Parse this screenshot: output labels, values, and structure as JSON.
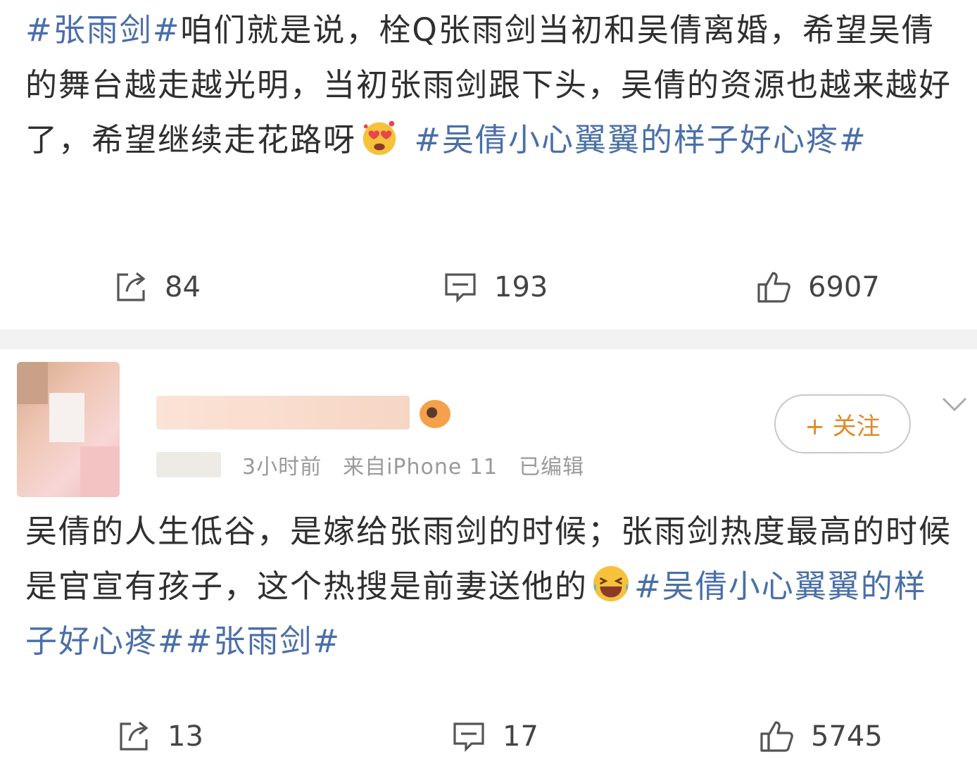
{
  "post1": {
    "text": [
      {
        "t": "#张雨剑#",
        "tag": true
      },
      {
        "t": "咱们就是说，栓Q张雨剑当初和吴倩离婚，希望吴倩的舞台越走越光明，当初张雨剑跟下头，吴倩的资源也越来越好了，希望继续走花路呀",
        "tag": false
      },
      {
        "emoji": "heart-eyes"
      },
      {
        "t": " #吴倩小心翼翼的样子好心疼#",
        "tag": true
      }
    ],
    "actions": {
      "repost": "84",
      "comment": "193",
      "like": "6907"
    }
  },
  "post2": {
    "meta": {
      "time": "3小时前",
      "source": "来自iPhone 11",
      "edited": "已编辑"
    },
    "follow_label": "+ 关注",
    "text": [
      {
        "t": "吴倩的人生低谷，是嫁给张雨剑的时候；张雨剑热度最高的时候是官宣有孩子，这个热搜是前妻送他的",
        "tag": false
      },
      {
        "emoji": "laughing"
      },
      {
        "t": "#吴倩小心翼翼的样子好心疼##张雨剑#",
        "tag": true
      }
    ],
    "actions": {
      "repost": "13",
      "comment": "17",
      "like": "5745"
    }
  },
  "colors": {
    "tag": "#4a6fa8",
    "text": "#2f2f2f",
    "separator": "#f2f2f2",
    "follow": "#e08a2a"
  },
  "icons": {
    "repost": "repost-icon",
    "comment": "comment-icon",
    "like": "thumbs-up-icon"
  }
}
